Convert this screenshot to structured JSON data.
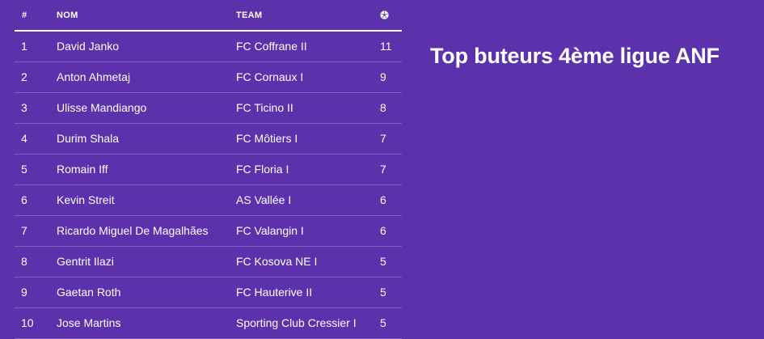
{
  "title": "Top buteurs 4ème ligue ANF",
  "table": {
    "headers": {
      "rank": "#",
      "name": "NOM",
      "team": "TEAM",
      "goals_icon": "soccer-ball-icon"
    },
    "rows": [
      {
        "rank": "1",
        "name": "David Janko",
        "team": "FC Coffrane II",
        "goals": "11"
      },
      {
        "rank": "2",
        "name": "Anton Ahmetaj",
        "team": "FC Cornaux I",
        "goals": "9"
      },
      {
        "rank": "3",
        "name": "Ulisse Mandiango",
        "team": "FC Ticino II",
        "goals": "8"
      },
      {
        "rank": "4",
        "name": "Durim Shala",
        "team": "FC Môtiers I",
        "goals": "7"
      },
      {
        "rank": "5",
        "name": "Romain Iff",
        "team": "FC Floria I",
        "goals": "7"
      },
      {
        "rank": "6",
        "name": "Kevin Streit",
        "team": "AS Vallée I",
        "goals": "6"
      },
      {
        "rank": "7",
        "name": "Ricardo Miguel De Magalhães",
        "team": "FC Valangin I",
        "goals": "6"
      },
      {
        "rank": "8",
        "name": "Gentrit Ilazi",
        "team": "FC Kosova NE I",
        "goals": "5"
      },
      {
        "rank": "9",
        "name": "Gaetan Roth",
        "team": "FC Hauterive II",
        "goals": "5"
      },
      {
        "rank": "10",
        "name": "Jose Martins",
        "team": "Sporting Club Cressier I",
        "goals": "5"
      }
    ]
  },
  "colors": {
    "background": "#5b31ac",
    "text": "#ffffff"
  }
}
